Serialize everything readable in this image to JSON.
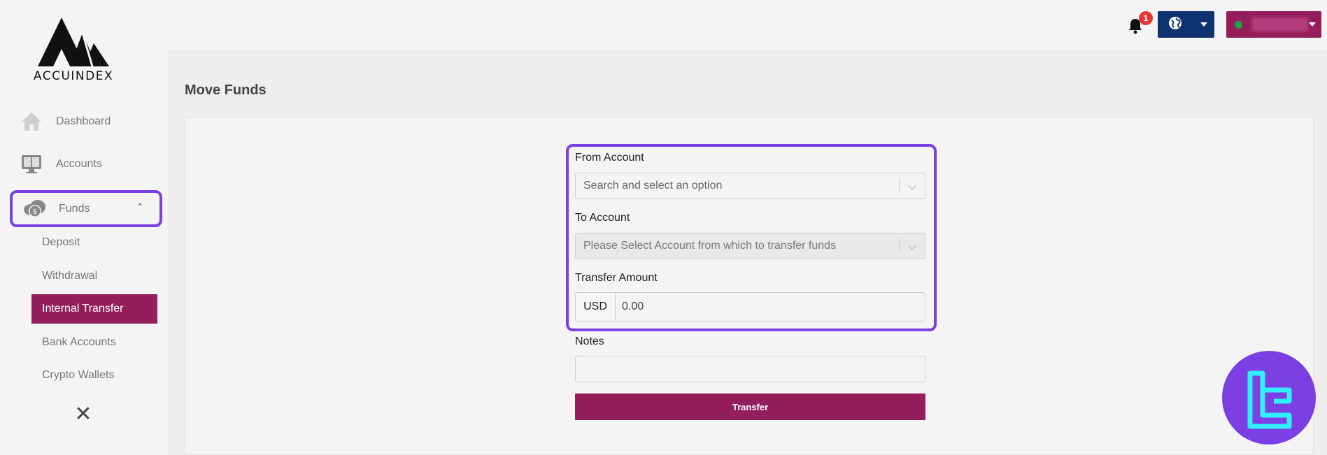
{
  "brand": {
    "name": "ACCUINDEX"
  },
  "sidebar": {
    "items": [
      {
        "label": "Dashboard",
        "icon": "home-icon"
      },
      {
        "label": "Accounts",
        "icon": "accounts-monitor-icon"
      },
      {
        "label": "Funds",
        "icon": "cloud-dollar-icon",
        "expanded": true
      }
    ],
    "sub_items": [
      {
        "label": "Deposit",
        "active": false
      },
      {
        "label": "Withdrawal",
        "active": false
      },
      {
        "label": "Internal Transfer",
        "active": true
      },
      {
        "label": "Bank Accounts",
        "active": false
      },
      {
        "label": "Crypto Wallets",
        "active": false
      }
    ],
    "close_icon": "close-icon"
  },
  "topbar": {
    "notifications_count": "1",
    "language_icon": "globe-icon"
  },
  "page": {
    "title": "Move Funds"
  },
  "form": {
    "from_label": "From Account",
    "from_placeholder": "Search and select an option",
    "to_label": "To Account",
    "to_placeholder": "Please Select Account from which to transfer funds",
    "amount_label": "Transfer Amount",
    "currency": "USD",
    "amount_value": "0.00",
    "notes_label": "Notes",
    "notes_value": "",
    "submit_label": "Transfer"
  },
  "colors": {
    "brand": "#941e5c",
    "highlight": "#7b3fe4",
    "language_button": "#0f3270",
    "status_online": "#1fa045"
  }
}
